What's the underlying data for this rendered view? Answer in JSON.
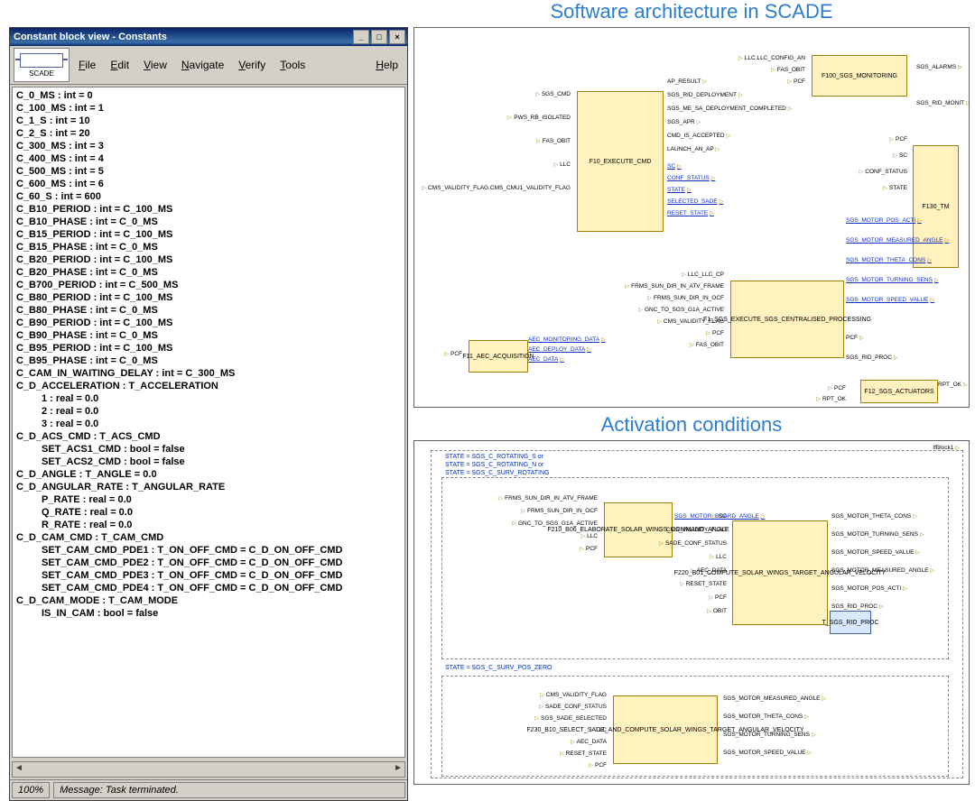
{
  "window": {
    "title": "Constant block view - Constants",
    "minimize": "_",
    "maximize": "□",
    "close": "×",
    "scade_label": "SCADE",
    "menu": {
      "file": {
        "label": "File",
        "accel": "F"
      },
      "edit": {
        "label": "Edit",
        "accel": "E"
      },
      "view": {
        "label": "View",
        "accel": "V"
      },
      "navigate": {
        "label": "Navigate",
        "accel": "N"
      },
      "verify": {
        "label": "Verify",
        "accel": "V"
      },
      "tools": {
        "label": "Tools",
        "accel": "T"
      },
      "help": {
        "label": "Help",
        "accel": "H"
      }
    },
    "constants": [
      {
        "t": "C_0_MS : int = 0"
      },
      {
        "t": "C_100_MS : int = 1"
      },
      {
        "t": "C_1_S : int = 10"
      },
      {
        "t": "C_2_S : int = 20"
      },
      {
        "t": "C_300_MS : int = 3"
      },
      {
        "t": "C_400_MS : int = 4"
      },
      {
        "t": "C_500_MS : int = 5"
      },
      {
        "t": "C_600_MS : int = 6"
      },
      {
        "t": "C_60_S : int = 600"
      },
      {
        "t": "C_B10_PERIOD : int = C_100_MS"
      },
      {
        "t": "C_B10_PHASE : int = C_0_MS"
      },
      {
        "t": "C_B15_PERIOD : int = C_100_MS"
      },
      {
        "t": "C_B15_PHASE : int = C_0_MS"
      },
      {
        "t": "C_B20_PERIOD : int = C_100_MS"
      },
      {
        "t": "C_B20_PHASE : int = C_0_MS"
      },
      {
        "t": "C_B700_PERIOD : int = C_500_MS"
      },
      {
        "t": "C_B80_PERIOD : int = C_100_MS"
      },
      {
        "t": "C_B80_PHASE : int = C_0_MS"
      },
      {
        "t": "C_B90_PERIOD : int = C_100_MS"
      },
      {
        "t": "C_B90_PHASE : int = C_0_MS"
      },
      {
        "t": "C_B95_PERIOD : int = C_100_MS"
      },
      {
        "t": "C_B95_PHASE : int = C_0_MS"
      },
      {
        "t": "C_CAM_IN_WAITING_DELAY : int = C_300_MS"
      },
      {
        "t": "C_D_ACCELERATION : T_ACCELERATION"
      },
      {
        "t": "1 : real = 0.0",
        "sub": true
      },
      {
        "t": "2 : real = 0.0",
        "sub": true
      },
      {
        "t": "3 : real = 0.0",
        "sub": true
      },
      {
        "t": "C_D_ACS_CMD : T_ACS_CMD"
      },
      {
        "t": "SET_ACS1_CMD : bool = false",
        "sub": true
      },
      {
        "t": "SET_ACS2_CMD : bool = false",
        "sub": true
      },
      {
        "t": "C_D_ANGLE : T_ANGLE = 0.0"
      },
      {
        "t": "C_D_ANGULAR_RATE : T_ANGULAR_RATE"
      },
      {
        "t": "P_RATE : real = 0.0",
        "sub": true
      },
      {
        "t": "Q_RATE : real = 0.0",
        "sub": true
      },
      {
        "t": "R_RATE : real = 0.0",
        "sub": true
      },
      {
        "t": "C_D_CAM_CMD : T_CAM_CMD"
      },
      {
        "t": "SET_CAM_CMD_PDE1 : T_ON_OFF_CMD = C_D_ON_OFF_CMD",
        "sub": true
      },
      {
        "t": "SET_CAM_CMD_PDE2 : T_ON_OFF_CMD = C_D_ON_OFF_CMD",
        "sub": true
      },
      {
        "t": "SET_CAM_CMD_PDE3 : T_ON_OFF_CMD = C_D_ON_OFF_CMD",
        "sub": true
      },
      {
        "t": "SET_CAM_CMD_PDE4 : T_ON_OFF_CMD = C_D_ON_OFF_CMD",
        "sub": true
      },
      {
        "t": "C_D_CAM_MODE : T_CAM_MODE"
      },
      {
        "t": "IS_IN_CAM : bool = false",
        "sub": true
      }
    ],
    "status_pct": "100%",
    "status_msg": "Message: Task terminated."
  },
  "right": {
    "title_arch": "Software architecture in SCADE",
    "title_act": "Activation conditions",
    "arch_nodes": {
      "f10": "F10_EXECUTE_CMD",
      "f11": "F11_AEC_ACQUISITION",
      "f1": "F1_SGS_EXECUTE_SGS_CENTRALISED_PROCESSING",
      "f100": "F100_SGS_MONITORING",
      "f130": "F130_TM",
      "f12": "F12_SGS_ACTUATORS"
    },
    "arch_inputs_left": [
      "SGS_CMD",
      "PWS_RB_ISOLATED",
      "FAS_OBIT",
      "LLC",
      "CMS_VALIDITY_FLAG.CMS_CMU1_VALIDITY_FLAG",
      "LLC_LLC_CP",
      "FRMS_SUN_DIR_IN_ATV_FRAME",
      "FRMS_SUN_DIR_IN_OCF",
      "GNC_TO_SGS_G1A_ACTIVE",
      "CMS_VALIDITY_FLAG",
      "PCF",
      "FAS_OBIT"
    ],
    "arch_inputs_top": [
      "LLC.LLC_CONFIG_AN",
      "FAS_OBIT",
      "PCF"
    ],
    "arch_outputs_center": [
      "AP_RESULT",
      "SGS_RID_DEPLOYMENT",
      "SGS_ME_SA_DEPLOYMENT_COMPLETED",
      "SGS_APR",
      "CMD_IS_ACCEPTED",
      "LAUNCH_AN_AP"
    ],
    "arch_bus_signals": [
      "SC",
      "CONF_STATUS",
      "STATE",
      "SELECTED_SADE",
      "RESET_STATE"
    ],
    "arch_f11_outputs": [
      "AEC_MONITORING_DATA",
      "AEC_DEPLOY_DATA",
      "AEC_DATA"
    ],
    "arch_outputs_right": [
      "SGS_ALARMS",
      "SGS_RID_MONIT",
      "PCF",
      "SC",
      "CONF_STATUS",
      "STATE",
      "SGS_MOTOR_POS_ACTI",
      "SGS_MOTOR_MEASURED_ANGLE",
      "SGS_MOTOR_THETA_CONS",
      "SGS_MOTOR_TURNING_SENS",
      "SGS_MOTOR_SPEED_VALUE",
      "PCF",
      "SGS_RID_PROC",
      "PCF",
      "RPT_OK"
    ],
    "act_cond1_lines": [
      "STATE = SGS_C_ROTATING_S or",
      "STATE = SGS_C_ROTATING_N or",
      "STATE = SGS_C_SURV_ROTATING"
    ],
    "act_cond2": "STATE = SGS_C_SURV_POS_ZERO",
    "act_panel_label": "IfBlock1",
    "act_nodes": {
      "f210": "F210_B06_ELABORATE_SOLAR_WINGS_COMMAND_ANGLE",
      "f220": "F220_B01_COMPUTE_SOLAR_WINGS_TARGET_ANGULAR_VELOCITY",
      "f230": "F230_B10_SELECT_SADE_AND_COMPUTE_SOLAR_WINGS_TARGET_ANGULAR_VELOCITY",
      "proc": "T_SGS_RID_PROC"
    },
    "act_inputs_top": [
      "FRMS_SUN_DIR_IN_ATV_FRAME",
      "FRMS_SUN_DIR_IN_OCF",
      "GNC_TO_SGS_G1A_ACTIVE",
      "LLC",
      "PCF"
    ],
    "act_mid_signals": [
      "SGS_MOTOR_BOARD_ANGLE",
      "SC",
      "CMS_VALIDITY_FLAG",
      "SADE_CONF_STATUS",
      "LLC",
      "AEC_DATA",
      "RESET_STATE",
      "PCF",
      "OBIT"
    ],
    "act_outputs_top": [
      "SGS_MOTOR_THETA_CONS",
      "SGS_MOTOR_TURNING_SENS",
      "SGS_MOTOR_SPEED_VALUE",
      "SGS_MOTOR_MEASURED_ANGLE",
      "SGS_MOTOR_POS_ACTI",
      "SGS_RID_PROC"
    ],
    "act_inputs_bot": [
      "CMS_VALIDITY_FLAG",
      "SADE_CONF_STATUS",
      "SGS_SADE_SELECTED",
      "LLC",
      "AEC_DATA",
      "RESET_STATE",
      "PCF"
    ],
    "act_outputs_bot": [
      "SGS_MOTOR_MEASURED_ANGLE",
      "SGS_MOTOR_THETA_CONS",
      "SGS_MOTOR_TURNING_SENS",
      "SGS_MOTOR_SPEED_VALUE"
    ]
  }
}
